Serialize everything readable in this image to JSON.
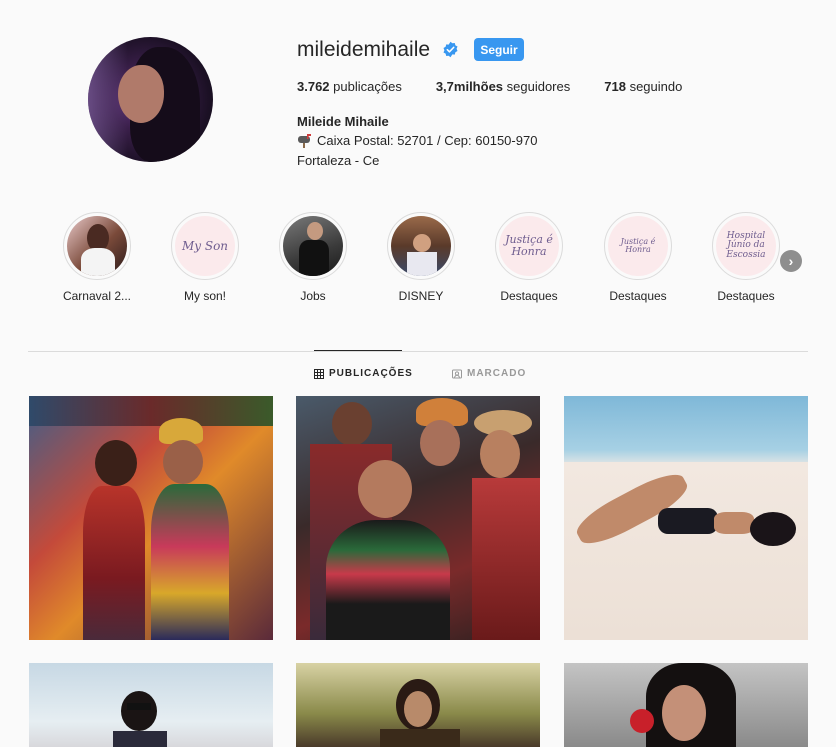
{
  "profile": {
    "username": "mileidemihaile",
    "follow_label": "Seguir",
    "full_name": "Mileide Mihaile",
    "bio_line1": "Caixa Postal: 52701 / Cep: 60150-970",
    "bio_line2": "Fortaleza - Ce",
    "bio_icon": "mailbox-icon",
    "verified_icon": "verified-badge-icon",
    "accent_color": "#3897f0"
  },
  "stats": {
    "posts_count": "3.762",
    "posts_label": " publicações",
    "followers_count": "3,7milhões",
    "followers_label": " seguidores",
    "following_count": "718",
    "following_label": " seguindo"
  },
  "highlights": [
    {
      "label": "Carnaval 2...",
      "cover_text": ""
    },
    {
      "label": "My son!",
      "cover_text": "My Son"
    },
    {
      "label": "Jobs",
      "cover_text": ""
    },
    {
      "label": "DISNEY",
      "cover_text": ""
    },
    {
      "label": "Destaques",
      "cover_text": "Justiça é Honra"
    },
    {
      "label": "Destaques",
      "cover_text": "Justiça é Honra"
    },
    {
      "label": "Destaques",
      "cover_text": "Hospital Júnio da Escossia"
    }
  ],
  "highlights_next_icon": "chevron-right-icon",
  "tabs": [
    {
      "label": "PUBLICAÇÕES",
      "icon": "grid-icon",
      "active": true
    },
    {
      "label": "MARCADO",
      "icon": "tag-icon",
      "active": false
    }
  ]
}
